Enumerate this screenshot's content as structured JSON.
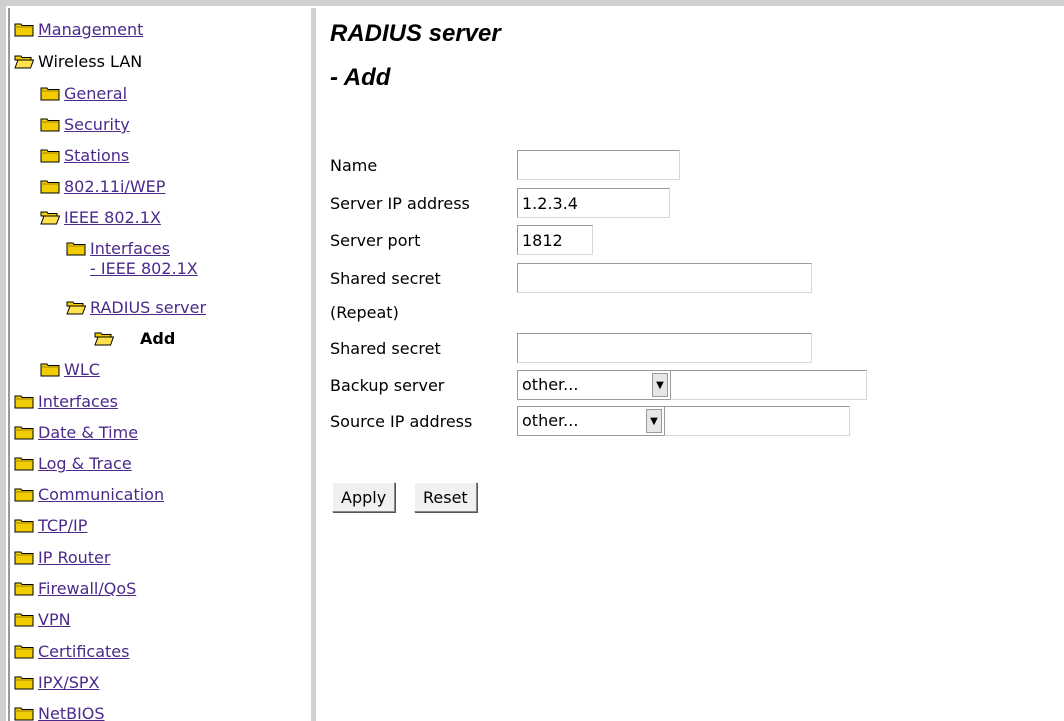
{
  "sidebar": {
    "items": [
      {
        "label": "Management",
        "link": true
      },
      {
        "label": "Wireless LAN",
        "link": false
      },
      {
        "label": "General",
        "link": true
      },
      {
        "label": "Security",
        "link": true
      },
      {
        "label": "Stations",
        "link": true
      },
      {
        "label": "802.11i/WEP",
        "link": true
      },
      {
        "label": "IEEE 802.1X",
        "link": true
      },
      {
        "label_line1": "Interfaces",
        "label_line2": "- IEEE 802.1X",
        "link": true
      },
      {
        "label": "RADIUS server",
        "link": true
      },
      {
        "label": "Add",
        "link": false
      },
      {
        "label": "WLC",
        "link": true
      },
      {
        "label": "Interfaces",
        "link": true
      },
      {
        "label": "Date & Time",
        "link": true
      },
      {
        "label": "Log & Trace",
        "link": true
      },
      {
        "label": "Communication",
        "link": true
      },
      {
        "label": "TCP/IP",
        "link": true
      },
      {
        "label": "IP Router",
        "link": true
      },
      {
        "label": "Firewall/QoS",
        "link": true
      },
      {
        "label": "VPN",
        "link": true
      },
      {
        "label": "Certificates",
        "link": true
      },
      {
        "label": "IPX/SPX",
        "link": true
      },
      {
        "label": "NetBIOS",
        "link": true
      }
    ]
  },
  "main": {
    "title_line1": "RADIUS server",
    "title_line2": "- Add",
    "form": {
      "name_label": "Name",
      "name_value": "",
      "server_ip_label": "Server IP address",
      "server_ip_value": "1.2.3.4",
      "server_port_label": "Server port",
      "server_port_value": "1812",
      "shared_secret_label": "Shared secret",
      "shared_secret_value": "",
      "repeat_label": "(Repeat)",
      "shared_secret_repeat_label": "Shared secret",
      "shared_secret_repeat_value": "",
      "backup_server_label": "Backup server",
      "backup_server_select": "other...",
      "backup_server_value": "",
      "source_ip_label": "Source IP address",
      "source_ip_select": "other...",
      "source_ip_value": ""
    },
    "buttons": {
      "apply": "Apply",
      "reset": "Reset"
    }
  },
  "colors": {
    "link": "#4b2a8c",
    "folder": "#e8c000"
  },
  "icons": {
    "folder_closed": "folder-icon",
    "folder_open": "folder-open-icon"
  }
}
